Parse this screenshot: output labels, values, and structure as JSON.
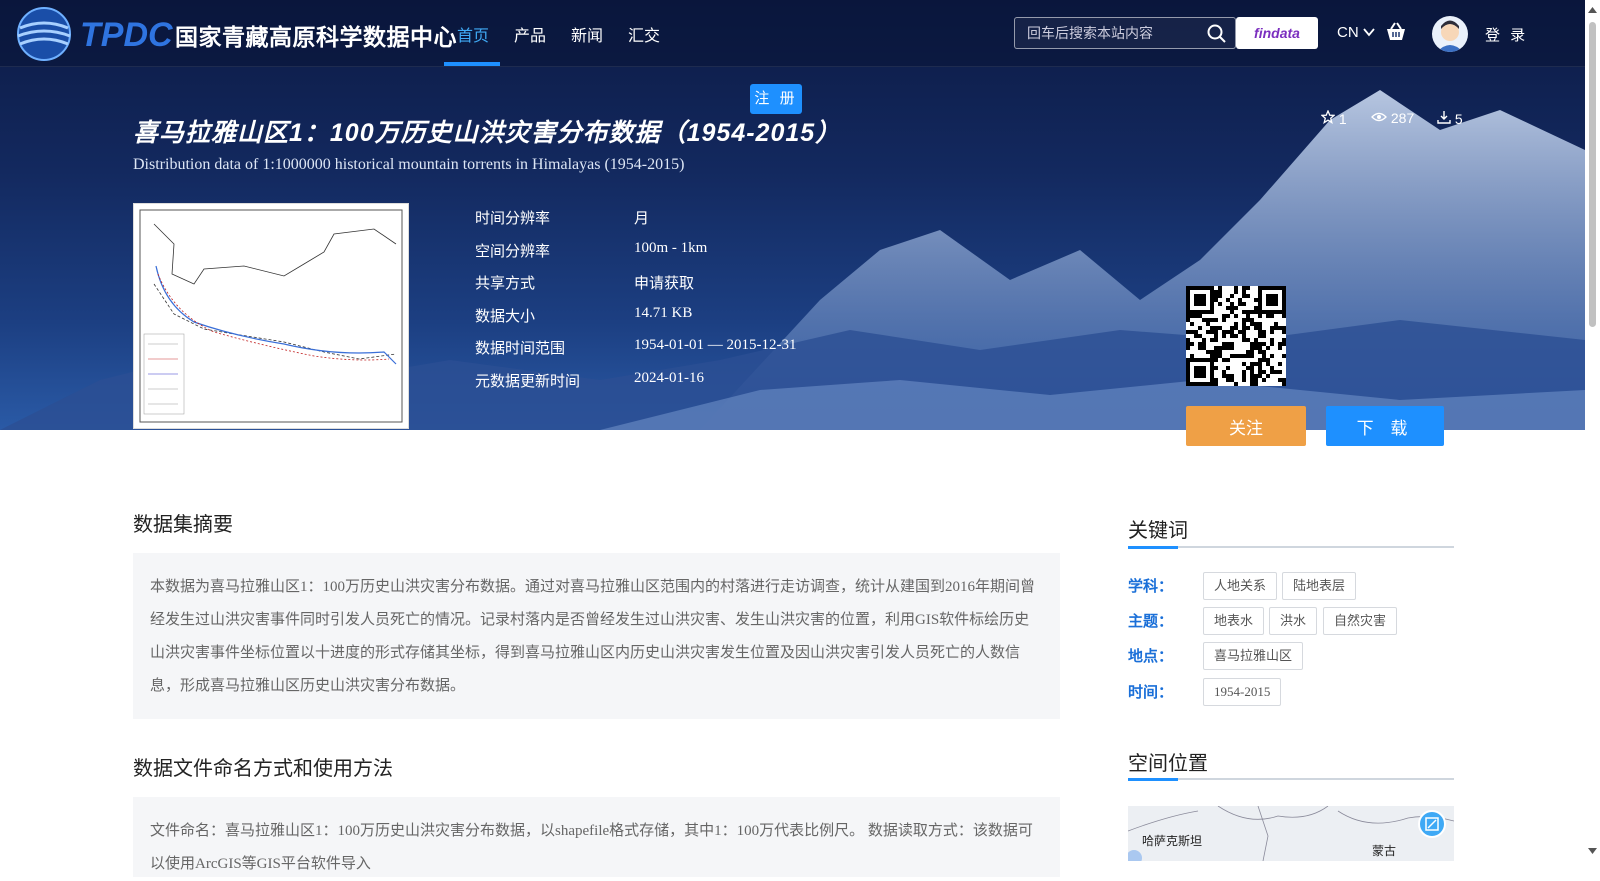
{
  "header": {
    "logo_text": "TPDC",
    "site_name": "国家青藏高原科学数据中心",
    "nav": [
      "首页",
      "产品",
      "新闻",
      "汇交"
    ],
    "search_placeholder": "回车后搜索本站内容",
    "findata": "findata",
    "lang": "CN",
    "login": "登 录",
    "register": "注 册"
  },
  "dataset": {
    "title_cn": "喜马拉雅山区1：100万历史山洪灾害分布数据（1954-2015）",
    "title_en": "Distribution data of 1:1000000 historical mountain torrents in Himalayas (1954-2015)",
    "stats": {
      "follows": "1",
      "views": "287",
      "downloads": "5"
    },
    "meta": [
      {
        "label": "时间分辨率",
        "value": "月"
      },
      {
        "label": "空间分辨率",
        "value": "100m - 1km"
      },
      {
        "label": "共享方式",
        "value": "申请获取"
      },
      {
        "label": "数据大小",
        "value": "14.71 KB"
      },
      {
        "label": "数据时间范围",
        "value": "1954-01-01 — 2015-12-31"
      },
      {
        "label": "元数据更新时间",
        "value": "2024-01-16"
      }
    ],
    "follow_label": "关注",
    "download_label": "下 载"
  },
  "abstract": {
    "heading": "数据集摘要",
    "text": "本数据为喜马拉雅山区1：100万历史山洪灾害分布数据。通过对喜马拉雅山区范围内的村落进行走访调查，统计从建国到2016年期间曾经发生过山洪灾害事件同时引发人员死亡的情况。记录村落内是否曾经发生过山洪灾害、发生山洪灾害的位置，利用GIS软件标绘历史山洪灾害事件坐标位置以十进度的形式存储其坐标，得到喜马拉雅山区内历史山洪灾害发生位置及因山洪灾害引发人员死亡的人数信息，形成喜马拉雅山区历史山洪灾害分布数据。"
  },
  "naming": {
    "heading": "数据文件命名方式和使用方法",
    "text": "文件命名：喜马拉雅山区1：100万历史山洪灾害分布数据，以shapefile格式存储，其中1：100万代表比例尺。 数据读取方式：该数据可以使用ArcGIS等GIS平台软件导入"
  },
  "keywords": {
    "heading": "关键词",
    "rows": [
      {
        "label": "学科：",
        "tags": [
          "人地关系",
          "陆地表层"
        ]
      },
      {
        "label": "主题：",
        "tags": [
          "地表水",
          "洪水",
          "自然灾害"
        ]
      },
      {
        "label": "地点：",
        "tags": [
          "喜马拉雅山区"
        ]
      },
      {
        "label": "时间：",
        "tags": [
          "1954-2015"
        ]
      }
    ]
  },
  "spatial": {
    "heading": "空间位置",
    "map_labels": [
      "哈萨克斯坦",
      "蒙古"
    ]
  }
}
